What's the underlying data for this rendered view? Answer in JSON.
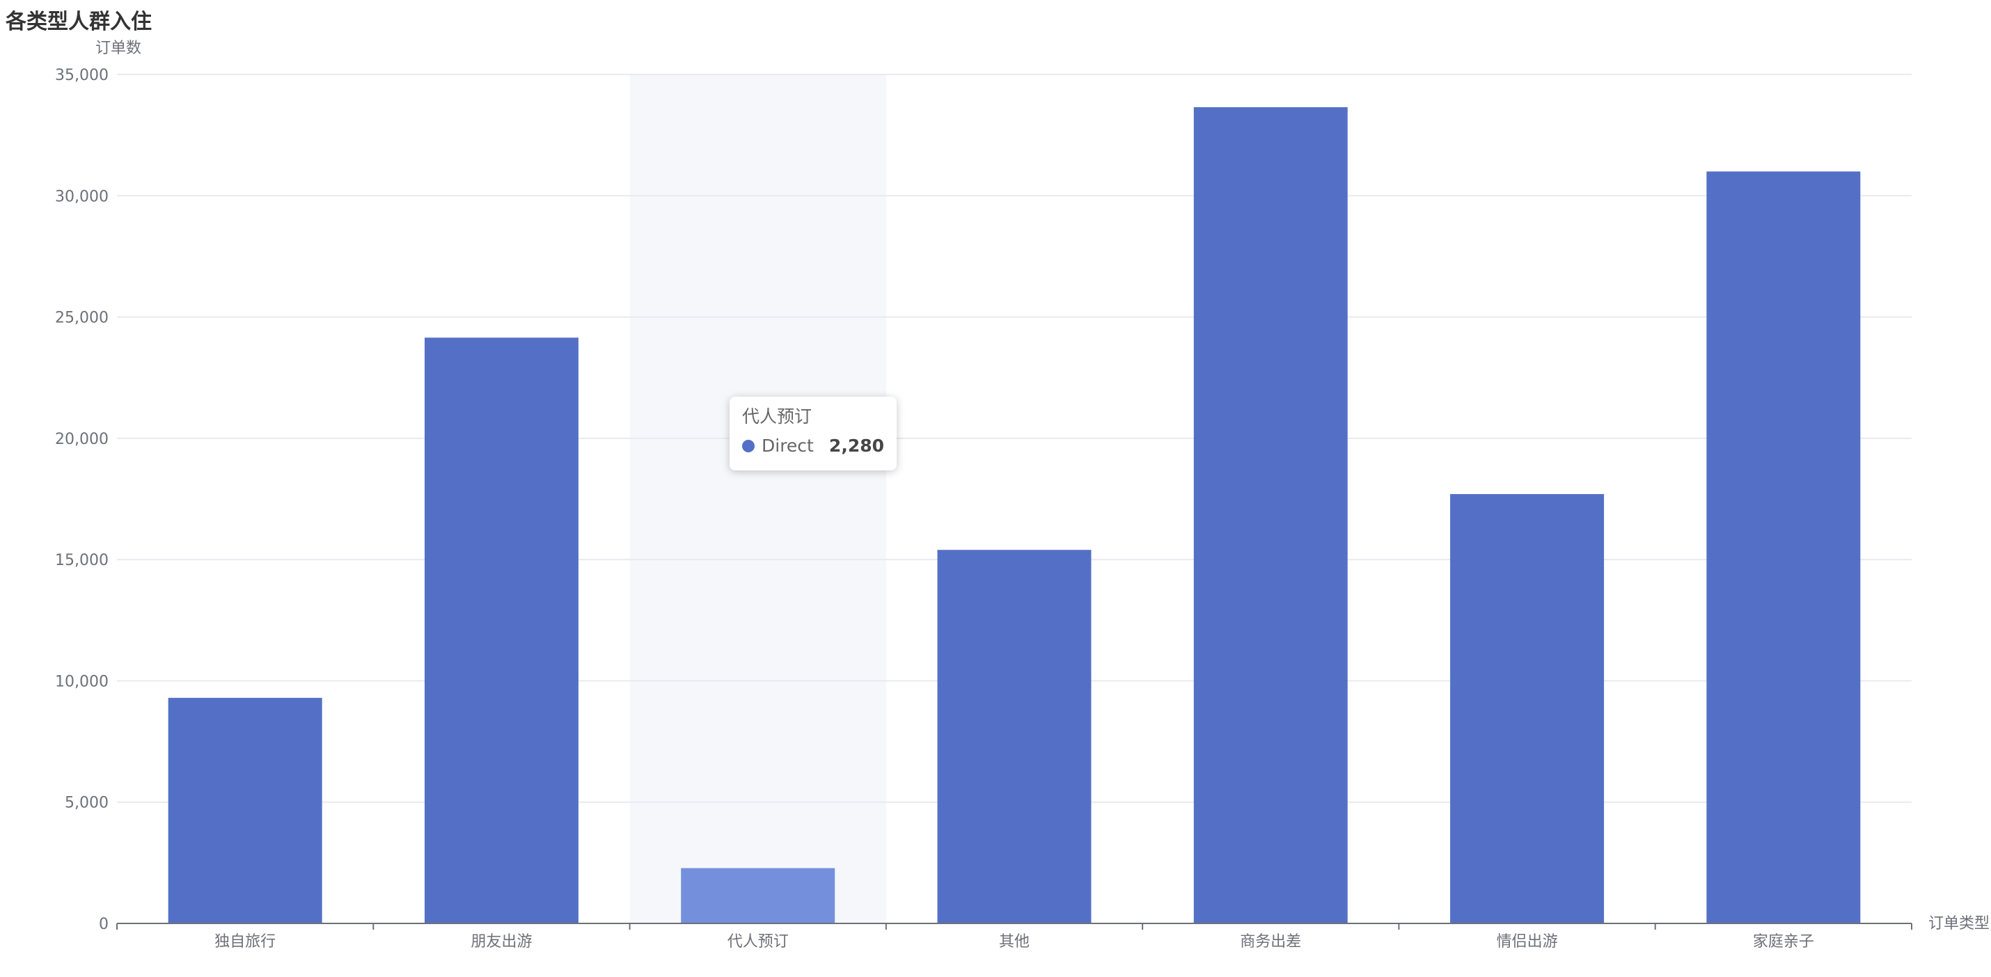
{
  "chart_data": {
    "type": "bar",
    "title": "各类型人群入住",
    "xlabel": "订单类型",
    "ylabel": "订单数",
    "categories": [
      "独自旅行",
      "朋友出游",
      "代人预订",
      "其他",
      "商务出差",
      "情侣出游",
      "家庭亲子"
    ],
    "series": [
      {
        "name": "Direct",
        "values": [
          9300,
          24150,
          2280,
          15400,
          33650,
          17700,
          31000
        ]
      }
    ],
    "ylim": [
      0,
      35000
    ],
    "yticks": [
      0,
      5000,
      10000,
      15000,
      20000,
      25000,
      30000,
      35000
    ],
    "ytick_labels": [
      "0",
      "5,000",
      "10,000",
      "15,000",
      "20,000",
      "25,000",
      "30,000",
      "35,000"
    ],
    "grid": true,
    "highlight_index": 2,
    "colors": {
      "bar": "#5470c6",
      "bar_highlight": "#7490dc",
      "hover_band": "#f5f7fb",
      "grid": "#e8eaf0",
      "axis": "#6e7079"
    }
  },
  "tooltip": {
    "title": "代人预订",
    "series_name": "Direct",
    "value": "2,280"
  }
}
